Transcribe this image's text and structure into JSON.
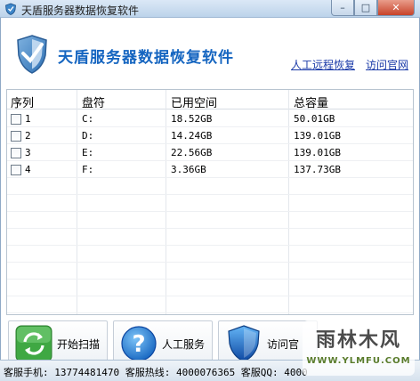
{
  "window": {
    "title": "天盾服务器数据恢复软件",
    "buttons": {
      "minimize": "–",
      "maximize": "□",
      "close": "✕"
    }
  },
  "header": {
    "brand": "天盾服务器数据恢复软件",
    "links": [
      {
        "label": "人工远程恢复"
      },
      {
        "label": "访问官网"
      }
    ]
  },
  "table": {
    "columns": [
      "序列",
      "盘符",
      "已用空间",
      "总容量"
    ],
    "rows": [
      {
        "index": "1",
        "drive": "C:",
        "used": "18.52GB",
        "total": "50.01GB",
        "checked": false
      },
      {
        "index": "2",
        "drive": "D:",
        "used": "14.24GB",
        "total": "139.01GB",
        "checked": false
      },
      {
        "index": "3",
        "drive": "E:",
        "used": "22.56GB",
        "total": "139.01GB",
        "checked": false
      },
      {
        "index": "4",
        "drive": "F:",
        "used": "3.36GB",
        "total": "137.73GB",
        "checked": false
      }
    ]
  },
  "actions": [
    {
      "label": "开始扫描",
      "icon": "refresh-icon"
    },
    {
      "label": "人工服务",
      "icon": "help-icon"
    },
    {
      "label": "访问官",
      "icon": "shield-icon"
    }
  ],
  "status": {
    "text": "客服手机: 13774481470 客服热线: 4000076365 客服QQ: 4000"
  },
  "watermark": {
    "title": "雨林木风",
    "url": "WWW.YLMFU.COM"
  },
  "colors": {
    "brand": "#1565c0",
    "link": "#1a3aa8",
    "scan_green": "#4caf50",
    "help_blue": "#1e88e5"
  }
}
